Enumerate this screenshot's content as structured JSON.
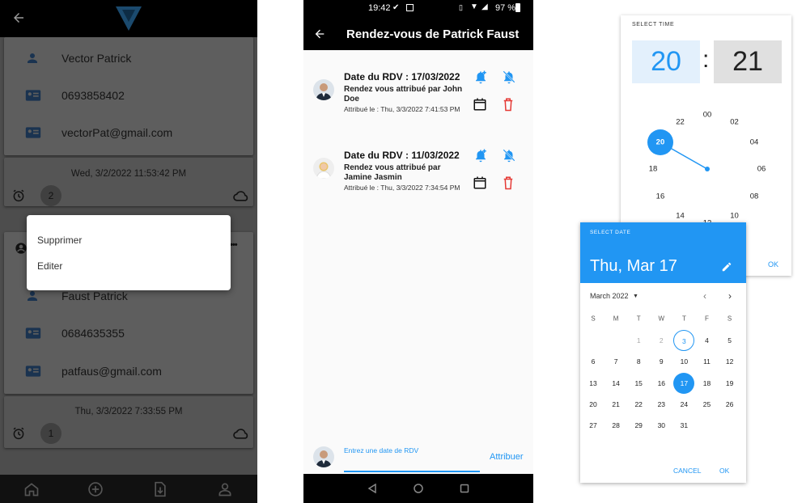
{
  "contacts_screen": {
    "card1": {
      "name": "Vector Patrick",
      "phone": "0693858402",
      "email": "vectorPat@gmail.com",
      "timestamp": "Wed, 3/2/2022 11:53:42 PM",
      "count": "2"
    },
    "card2": {
      "name": "Faust Patrick",
      "phone": "0684635355",
      "email": "patfaus@gmail.com",
      "timestamp": "Thu, 3/3/2022 7:33:55 PM",
      "count": "1"
    },
    "context_menu": {
      "delete": "Supprimer",
      "edit": "Editer"
    },
    "more_glyph": "•••"
  },
  "rdv_screen": {
    "status": {
      "time": "19:42",
      "battery": "97 %"
    },
    "title": "Rendez-vous de Patrick Faust",
    "appointments": [
      {
        "title": "Date du RDV : 17/03/2022",
        "by": "Rendez vous attribué par John Doe",
        "date": "Attribué le : Thu, 3/3/2022 7:41:53 PM"
      },
      {
        "title": "Date du RDV : 11/03/2022",
        "by": "Rendez vous attribué par Jamine Jasmin",
        "date": "Attribué le : Thu, 3/3/2022 7:34:54 PM"
      }
    ],
    "input_label": "Entrez une date de RDV",
    "assign_button": "Attribuer"
  },
  "time_picker": {
    "label": "SELECT TIME",
    "hour": "20",
    "separator": ":",
    "minute": "21",
    "ok": "OK",
    "dial_numbers": [
      "00",
      "02",
      "04",
      "06",
      "08",
      "10",
      "12",
      "14",
      "16",
      "18",
      "20",
      "22"
    ]
  },
  "date_picker": {
    "label": "SELECT DATE",
    "selected": "Thu, Mar 17",
    "month": "March 2022",
    "weekdays": [
      "S",
      "M",
      "T",
      "W",
      "T",
      "F",
      "S"
    ],
    "days": [
      "1",
      "2",
      "3",
      "4",
      "5",
      "6",
      "7",
      "8",
      "9",
      "10",
      "11",
      "12",
      "13",
      "14",
      "15",
      "16",
      "17",
      "18",
      "19",
      "20",
      "21",
      "22",
      "23",
      "24",
      "25",
      "26",
      "27",
      "28",
      "29",
      "30",
      "31"
    ],
    "cancel": "CANCEL",
    "ok": "OK"
  },
  "colors": {
    "accent": "#2196f3",
    "danger": "#e53935",
    "overlay": "#4d4d4d"
  }
}
